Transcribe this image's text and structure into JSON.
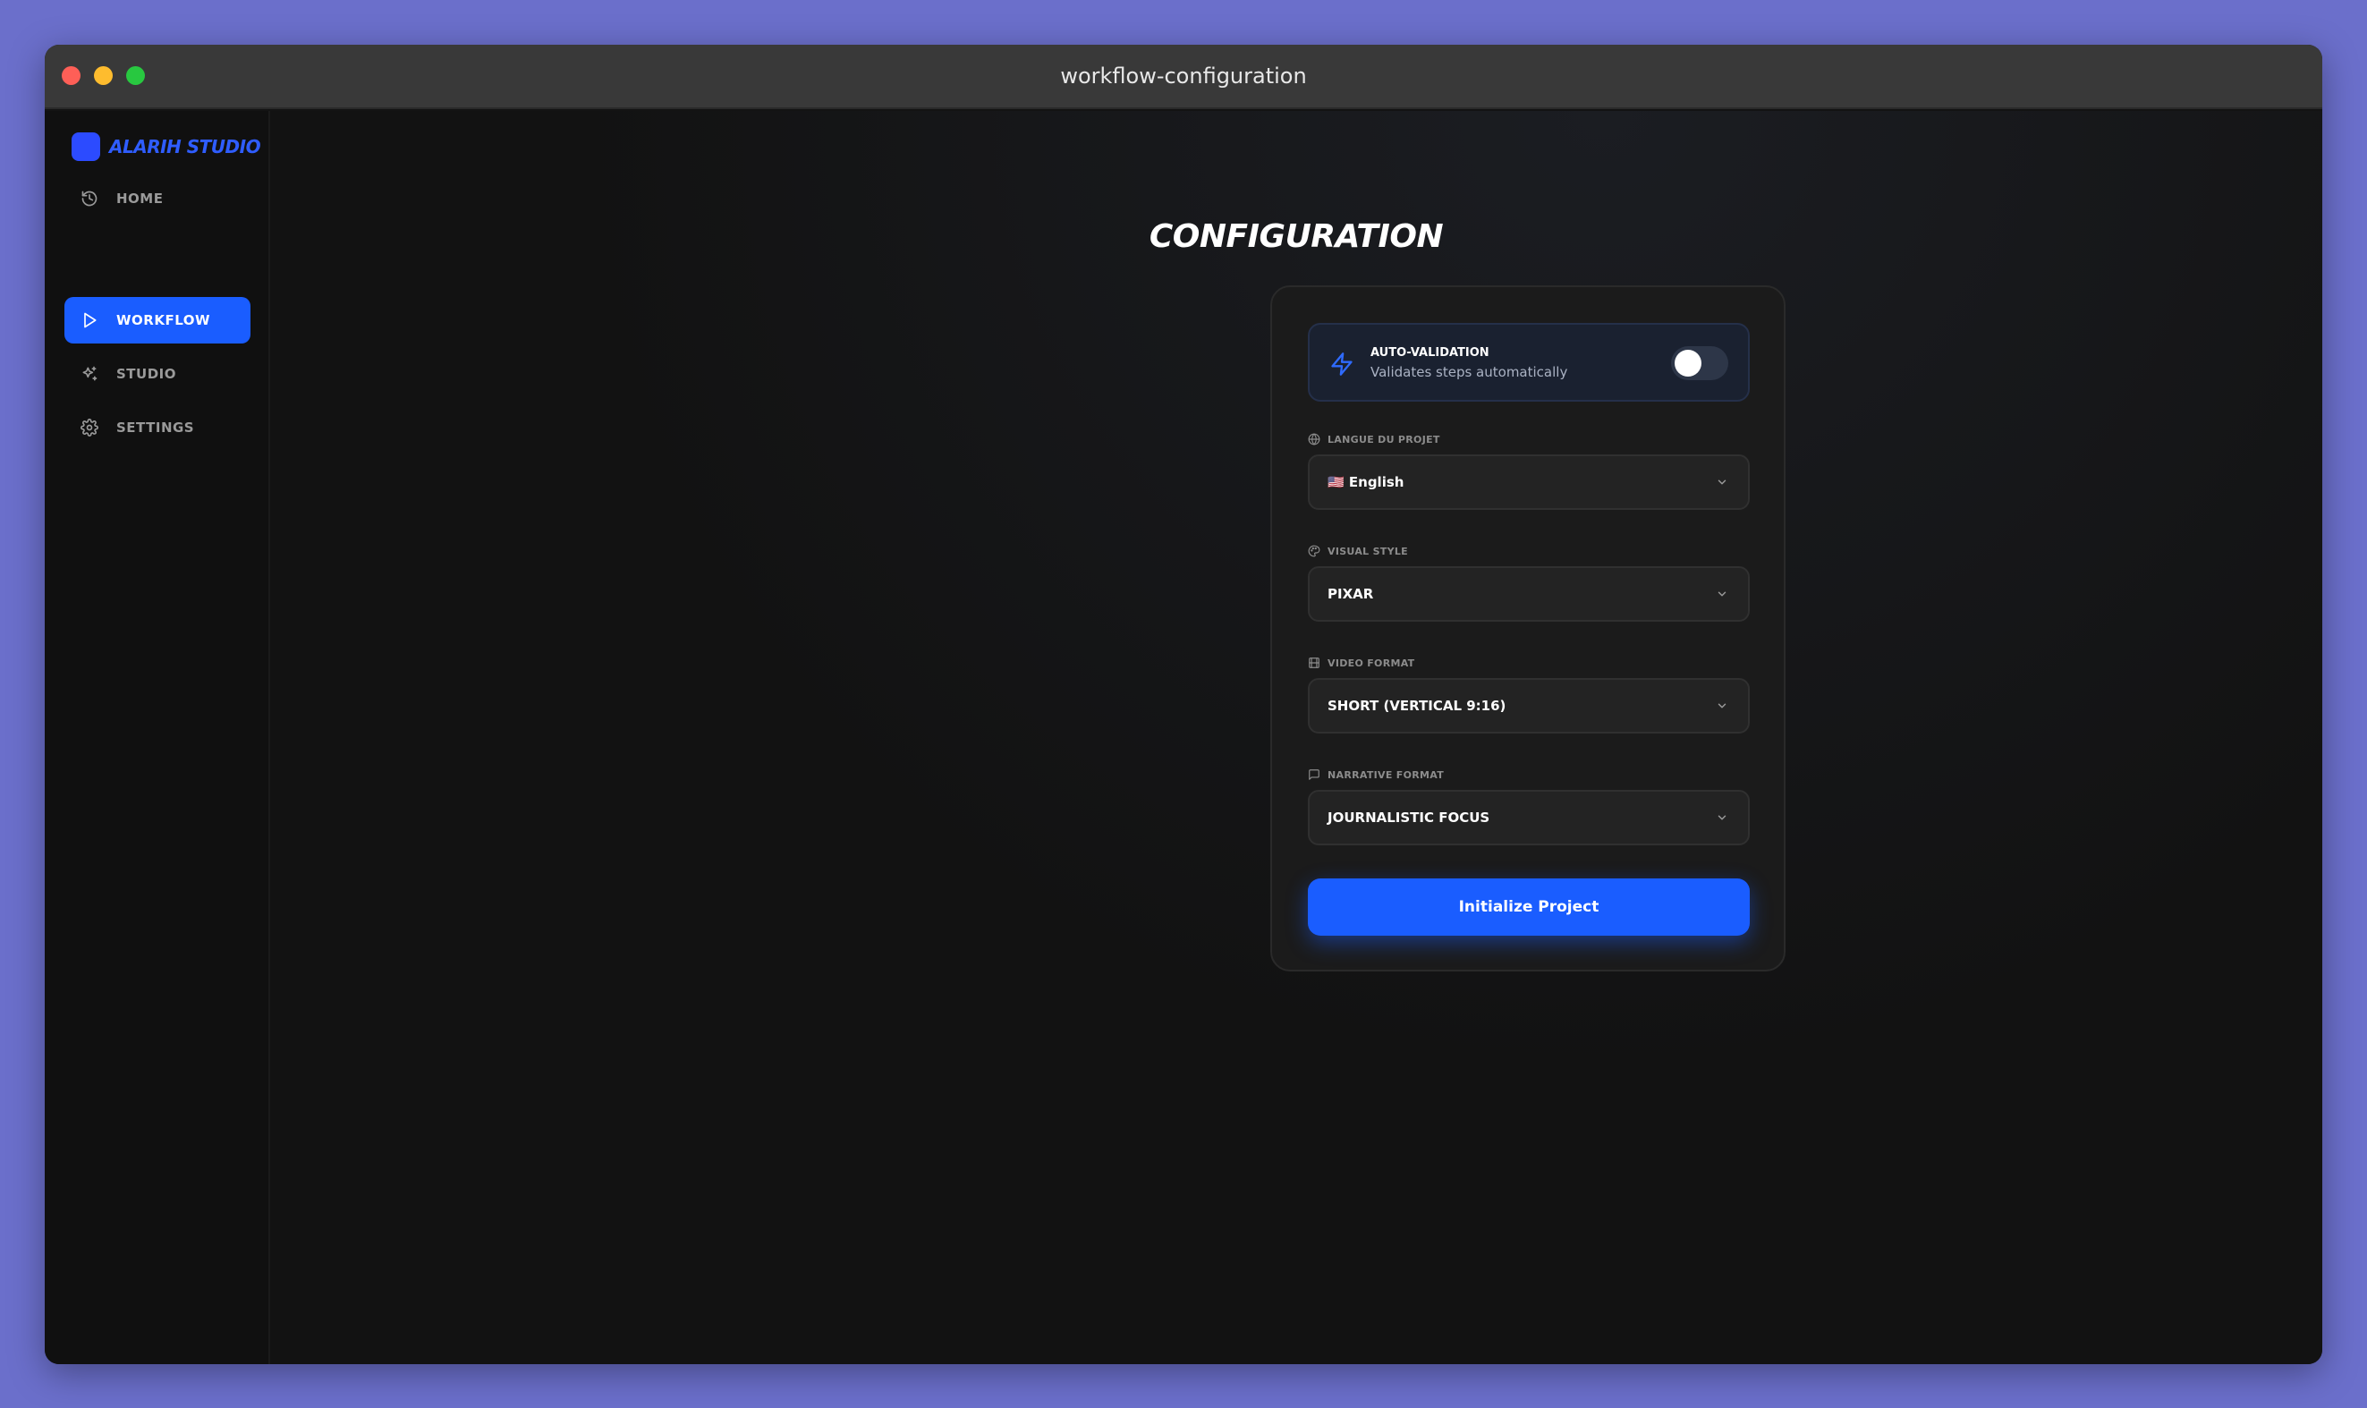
{
  "window": {
    "title": "workflow-configuration"
  },
  "sidebar": {
    "brand": "ALARIH STUDIO",
    "items": [
      {
        "label": "HOME",
        "icon": "history-icon",
        "active": false
      },
      {
        "label": "WORKFLOW",
        "icon": "play-icon",
        "active": true
      },
      {
        "label": "STUDIO",
        "icon": "sparkles-icon",
        "active": false
      },
      {
        "label": "SETTINGS",
        "icon": "gear-icon",
        "active": false
      }
    ]
  },
  "main": {
    "title": "CONFIGURATION",
    "auto_validation": {
      "title": "AUTO-VALIDATION",
      "subtitle": "Validates steps automatically",
      "enabled": false
    },
    "fields": [
      {
        "label": "LANGUE DU PROJET",
        "icon": "globe-icon",
        "value": "🇺🇸 English"
      },
      {
        "label": "VISUAL STYLE",
        "icon": "palette-icon",
        "value": "PIXAR"
      },
      {
        "label": "VIDEO FORMAT",
        "icon": "film-icon",
        "value": "SHORT (VERTICAL 9:16)"
      },
      {
        "label": "NARRATIVE FORMAT",
        "icon": "message-icon",
        "value": "JOURNALISTIC FOCUS"
      }
    ],
    "submit_label": "Initialize Project"
  },
  "colors": {
    "accent": "#1a5dff",
    "brand": "#2f5dff",
    "background": "#131313",
    "desktop": "#6b6fcb"
  }
}
